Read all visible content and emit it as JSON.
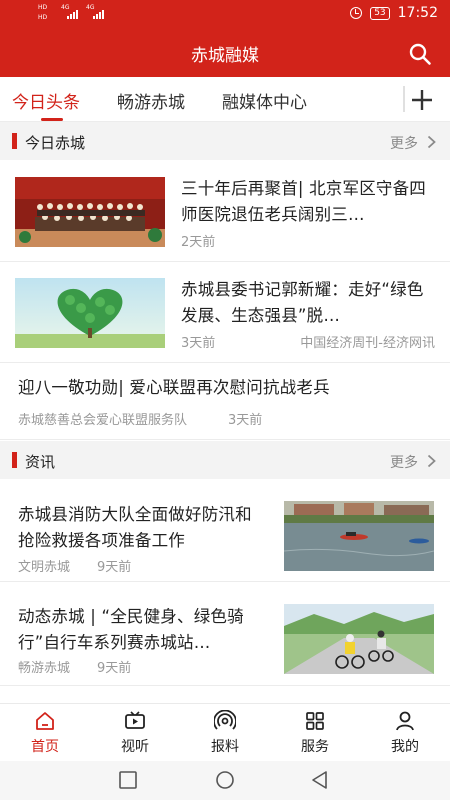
{
  "status_bar": {
    "sim1_tag": "HD",
    "sim1_net": "4G",
    "sim2_tag": "HD",
    "sim2_net": "4G",
    "battery": "53",
    "time": "17:52"
  },
  "header": {
    "title": "赤城融媒",
    "search_icon": "search-icon"
  },
  "tabs": {
    "items": [
      "今日头条",
      "畅游赤城",
      "融媒体中心"
    ],
    "active_index": 0,
    "add_icon": "plus-icon"
  },
  "sections": [
    {
      "title": "今日赤城",
      "more": "更多",
      "items": [
        {
          "title": "三十年后再聚首| 北京军区守备四师医院退伍老兵阔别三…",
          "source": "",
          "time": "2天前",
          "image": "group-photo-thumbnail"
        },
        {
          "title": "赤城县委书记郭新耀：走好“绿色发展、生态强县”脱…",
          "source": "中国经济周刊-经济网讯",
          "time": "3天前",
          "image": "green-heart-tree-thumbnail"
        },
        {
          "title": "迎八一敬功勋| 爱心联盟再次慰问抗战老兵",
          "source": "赤城慈善总会爱心联盟服务队",
          "time": "3天前"
        }
      ]
    },
    {
      "title": "资讯",
      "more": "更多",
      "items": [
        {
          "title": "赤城县消防大队全面做好防汛和抢险救援各项准备工作",
          "source": "文明赤城",
          "time": "9天前",
          "image": "rescue-boat-thumbnail"
        },
        {
          "title": "动态赤城 | “全民健身、绿色骑行”自行车系列赛赤城站…",
          "source": "畅游赤城",
          "time": "9天前",
          "image": "cyclists-thumbnail"
        }
      ]
    }
  ],
  "bottom_nav": [
    {
      "label": "首页",
      "icon": "home-icon",
      "active": true
    },
    {
      "label": "视听",
      "icon": "video-icon",
      "active": false
    },
    {
      "label": "报料",
      "icon": "broadcast-icon",
      "active": false
    },
    {
      "label": "服务",
      "icon": "grid-icon",
      "active": false
    },
    {
      "label": "我的",
      "icon": "user-icon",
      "active": false
    }
  ],
  "colors": {
    "brand_red": "#d2231a",
    "meta_gray": "#999999",
    "section_bg": "#f3f3f3"
  }
}
